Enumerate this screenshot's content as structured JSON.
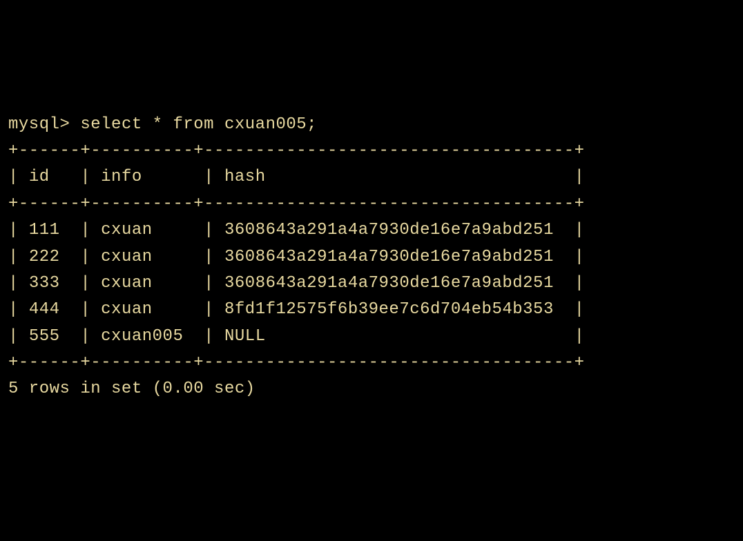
{
  "prompt": "mysql>",
  "query": "select * from cxuan005;",
  "columns": [
    "id",
    "info",
    "hash"
  ],
  "rows": [
    {
      "id": "111",
      "info": "cxuan",
      "hash": "3608643a291a4a7930de16e7a9abd251"
    },
    {
      "id": "222",
      "info": "cxuan",
      "hash": "3608643a291a4a7930de16e7a9abd251"
    },
    {
      "id": "333",
      "info": "cxuan",
      "hash": "3608643a291a4a7930de16e7a9abd251"
    },
    {
      "id": "444",
      "info": "cxuan",
      "hash": "8fd1f12575f6b39ee7c6d704eb54b353"
    },
    {
      "id": "555",
      "info": "cxuan005",
      "hash": "NULL"
    }
  ],
  "footer": "5 rows in set (0.00 sec)",
  "col_widths": {
    "id": 5,
    "info": 10,
    "hash": 34
  },
  "border_sep": "+------+----------+------------------------------------+"
}
